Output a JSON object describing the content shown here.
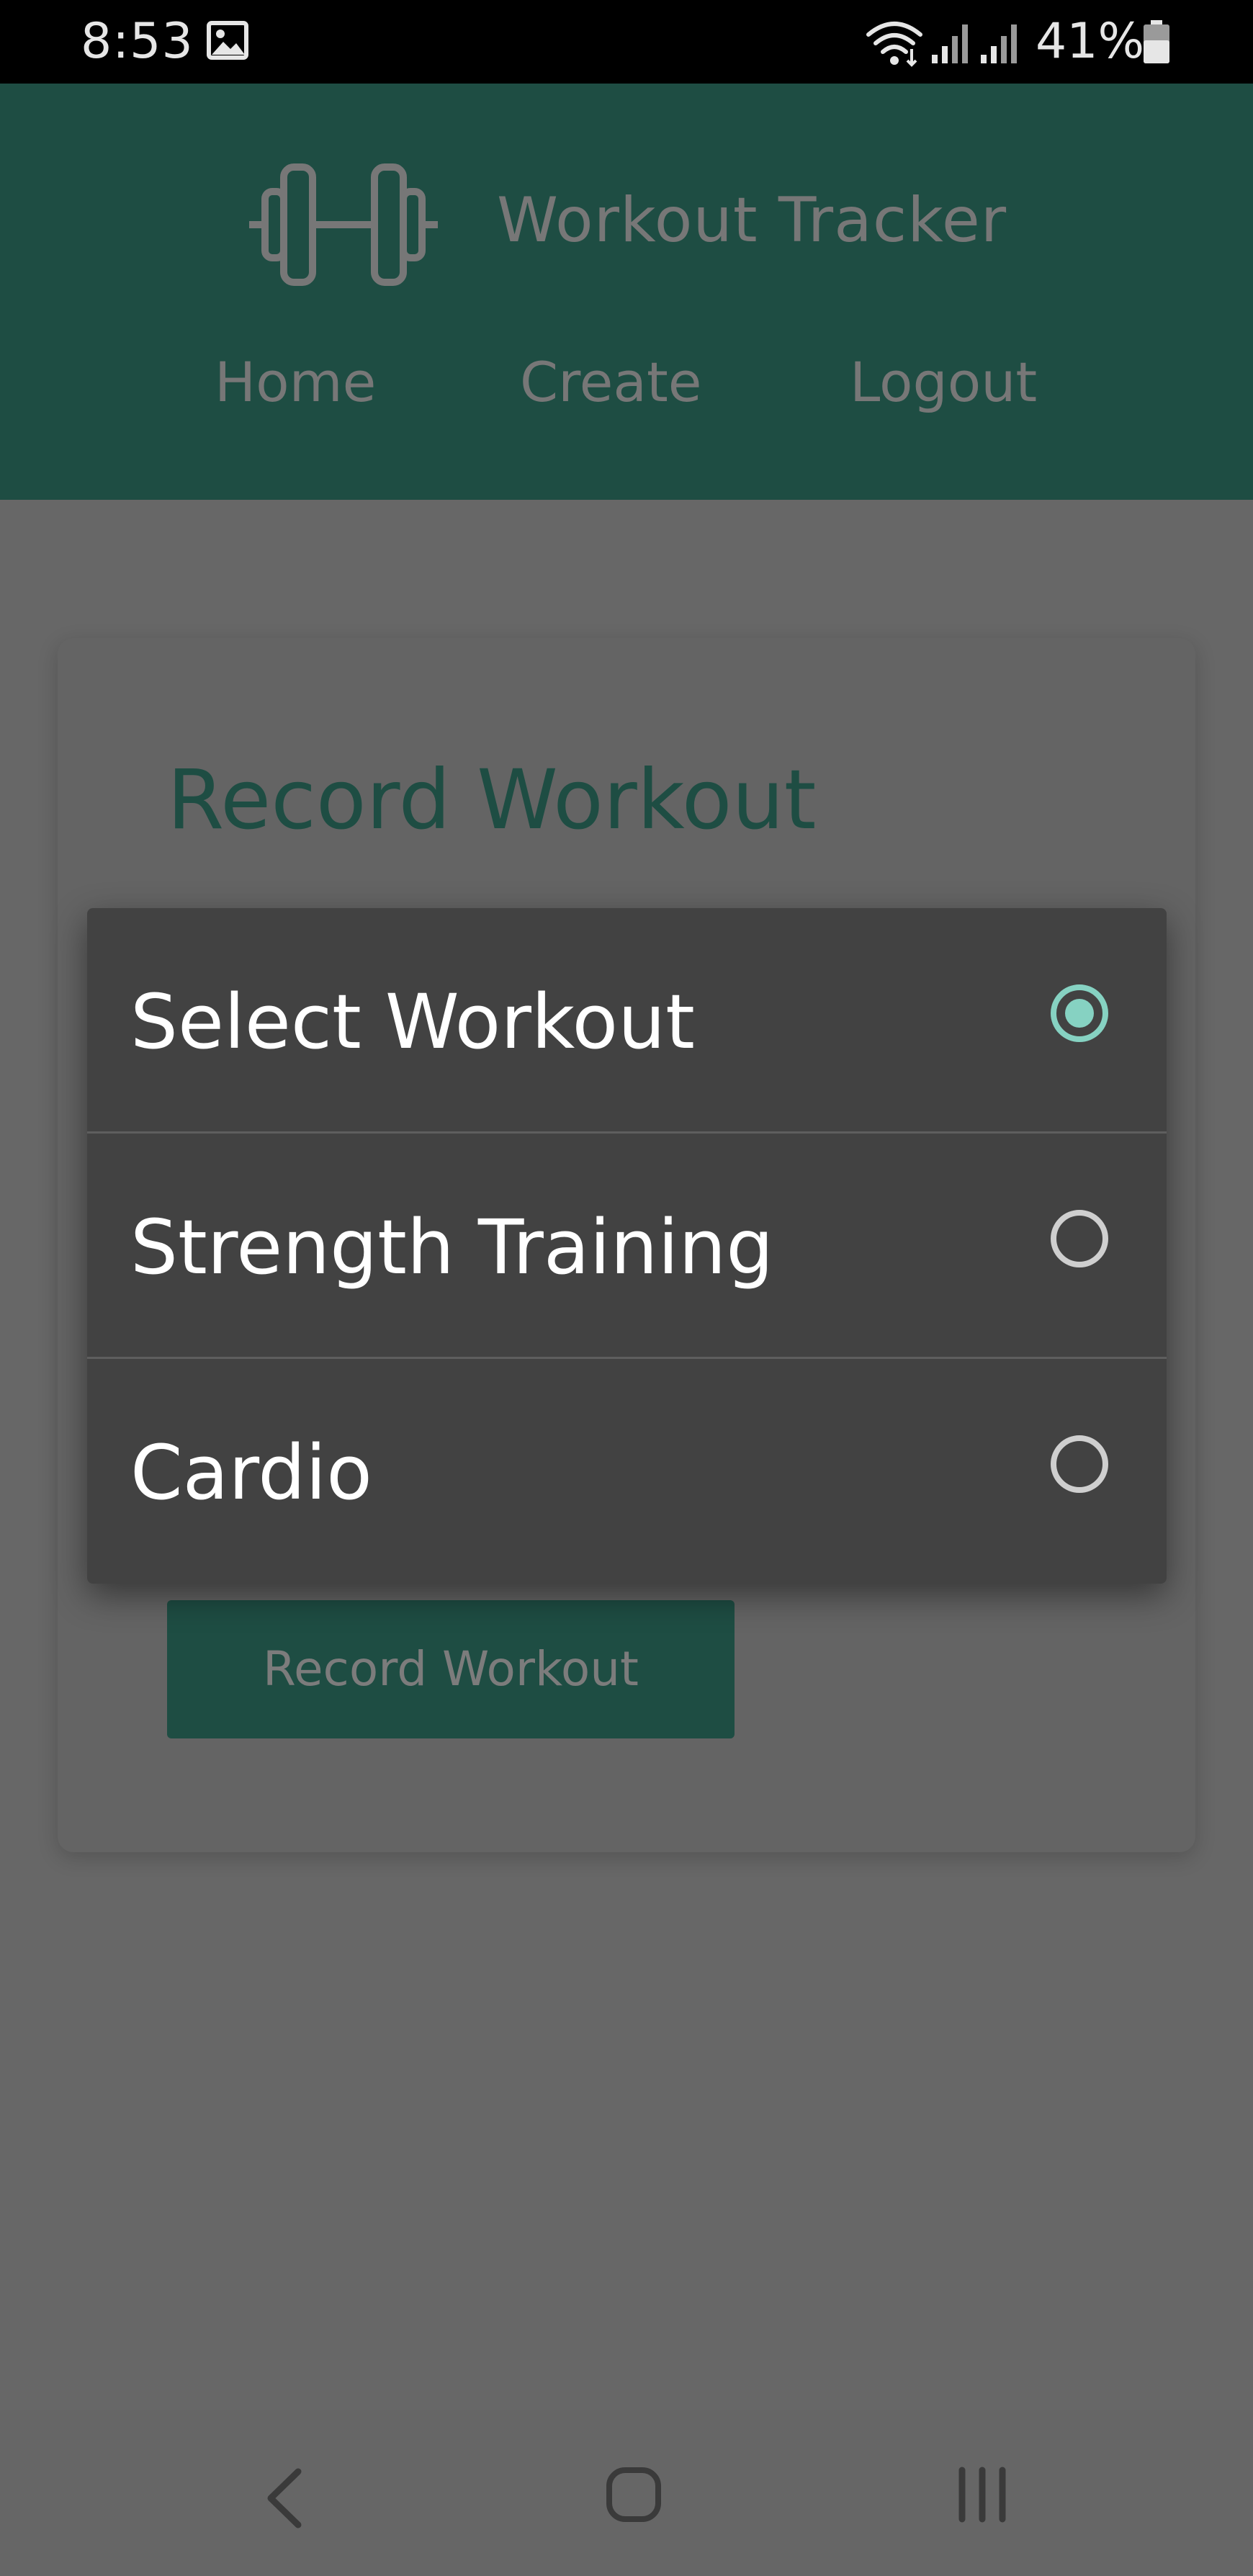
{
  "status_bar": {
    "time": "8:53",
    "battery": "41%"
  },
  "header": {
    "title": "Workout Tracker",
    "nav": {
      "home": "Home",
      "create": "Create",
      "logout": "Logout"
    }
  },
  "card": {
    "title": "Record Workout",
    "button_label": "Record Workout"
  },
  "dropdown": {
    "options": [
      {
        "label": "Select Workout",
        "selected": true
      },
      {
        "label": "Strength Training",
        "selected": false
      },
      {
        "label": "Cardio",
        "selected": false
      }
    ]
  },
  "colors": {
    "header_bg": "#1e4d43",
    "overlay_bg": "#676767",
    "dialog_bg": "#424242",
    "radio_accent": "#86d2c2"
  },
  "icons": {
    "logo": "dumbbell-icon",
    "gallery": "image-icon",
    "wifi": "wifi-icon",
    "signal": "signal-icon",
    "battery": "battery-icon",
    "back": "back-icon",
    "home": "home-icon",
    "recents": "recents-icon"
  }
}
